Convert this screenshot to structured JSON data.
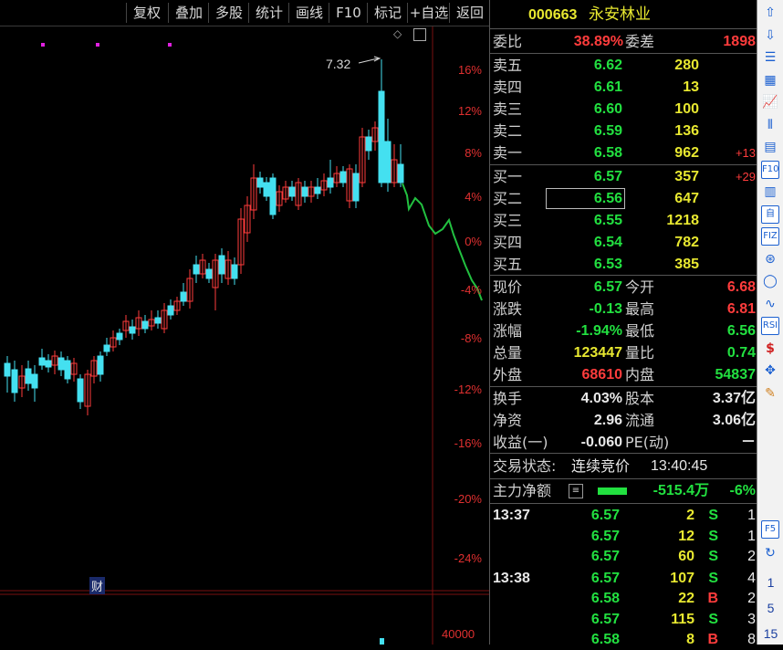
{
  "toolbar": {
    "items": [
      "复权",
      "叠加",
      "多股",
      "统计",
      "画线",
      "F10",
      "标记",
      "+自选",
      "返回"
    ]
  },
  "chart": {
    "pct_labels": [
      "16%",
      "12%",
      "8%",
      "4%",
      "0%",
      "-4%",
      "-8%",
      "-12%",
      "-16%",
      "-20%",
      "-24%"
    ],
    "peak_label": "7.32",
    "fin_marker": "财",
    "vol_label": "40000",
    "colors": {
      "up": "#ff3c3c",
      "down": "#44e0f0",
      "line": "#22c040"
    }
  },
  "quote": {
    "code": "000663",
    "name": "永安林业",
    "wei_bi": {
      "label": "委比",
      "value": "38.89%",
      "label2": "委差",
      "value2": "1898"
    },
    "sell": [
      {
        "label": "卖五",
        "price": "6.62",
        "vol": "280",
        "chg": ""
      },
      {
        "label": "卖四",
        "price": "6.61",
        "vol": "13",
        "chg": ""
      },
      {
        "label": "卖三",
        "price": "6.60",
        "vol": "100",
        "chg": ""
      },
      {
        "label": "卖二",
        "price": "6.59",
        "vol": "136",
        "chg": ""
      },
      {
        "label": "卖一",
        "price": "6.58",
        "vol": "962",
        "chg": "+13"
      }
    ],
    "buy": [
      {
        "label": "买一",
        "price": "6.57",
        "vol": "357",
        "chg": "+29"
      },
      {
        "label": "买二",
        "price": "6.56",
        "vol": "647",
        "chg": ""
      },
      {
        "label": "买三",
        "price": "6.55",
        "vol": "1218",
        "chg": ""
      },
      {
        "label": "买四",
        "price": "6.54",
        "vol": "782",
        "chg": ""
      },
      {
        "label": "买五",
        "price": "6.53",
        "vol": "385",
        "chg": ""
      }
    ],
    "stats": [
      {
        "l1": "现价",
        "v1": "6.57",
        "c1": "grn",
        "l2": "今开",
        "v2": "6.68",
        "c2": "red"
      },
      {
        "l1": "涨跌",
        "v1": "-0.13",
        "c1": "grn",
        "l2": "最高",
        "v2": "6.81",
        "c2": "red"
      },
      {
        "l1": "涨幅",
        "v1": "-1.94%",
        "c1": "grn",
        "l2": "最低",
        "v2": "6.56",
        "c2": "grn"
      },
      {
        "l1": "总量",
        "v1": "123447",
        "c1": "yel",
        "l2": "量比",
        "v2": "0.74",
        "c2": "grn"
      },
      {
        "l1": "外盘",
        "v1": "68610",
        "c1": "red",
        "l2": "内盘",
        "v2": "54837",
        "c2": "grn"
      }
    ],
    "stats2": [
      {
        "l1": "换手",
        "v1": "4.03%",
        "l2": "股本",
        "v2": "3.37亿"
      },
      {
        "l1": "净资",
        "v1": "2.96",
        "l2": "流通",
        "v2": "3.06亿"
      },
      {
        "l1": "收益(一)",
        "v1": "-0.060",
        "l2": "PE(动)",
        "v2": "－"
      }
    ],
    "status": {
      "label": "交易状态:",
      "value": "连续竞价",
      "time": "13:40:45"
    },
    "main_flow": {
      "label": "主力净额",
      "value": "-515.4万",
      "pct": "-6%"
    },
    "ticks": [
      {
        "time": "13:37",
        "price": "6.57",
        "pc": "grn",
        "vol": "2",
        "side": "S",
        "n": "1"
      },
      {
        "time": "",
        "price": "6.57",
        "pc": "grn",
        "vol": "12",
        "side": "S",
        "n": "1"
      },
      {
        "time": "",
        "price": "6.57",
        "pc": "grn",
        "vol": "60",
        "side": "S",
        "n": "2"
      },
      {
        "time": "13:38",
        "price": "6.57",
        "pc": "grn",
        "vol": "107",
        "side": "S",
        "n": "4"
      },
      {
        "time": "",
        "price": "6.58",
        "pc": "grn",
        "vol": "22",
        "side": "B",
        "n": "2"
      },
      {
        "time": "",
        "price": "6.57",
        "pc": "grn",
        "vol": "115",
        "side": "S",
        "n": "3"
      },
      {
        "time": "",
        "price": "6.58",
        "pc": "grn",
        "vol": "8",
        "side": "B",
        "n": "8"
      }
    ]
  },
  "sidebar": {
    "icons": [
      "up-arrow-icon",
      "down-arrow-icon",
      "list-icon",
      "grid-icon",
      "line-chart-icon",
      "candle-icon",
      "doc-icon",
      "f10-icon",
      "table-icon",
      "zi-icon",
      "fiz-icon",
      "tianyan-icon",
      "circle-icon",
      "wave-icon",
      "rsi-icon",
      "dollar-icon",
      "move-icon",
      "pen-icon",
      "f5-icon",
      "refresh-icon"
    ],
    "rsi_label": "RSI",
    "f10_label": "F10",
    "f5_label": "F5",
    "fiz_label": "FIZ",
    "zi_label": "自",
    "nums": [
      "1",
      "5",
      "15"
    ]
  }
}
